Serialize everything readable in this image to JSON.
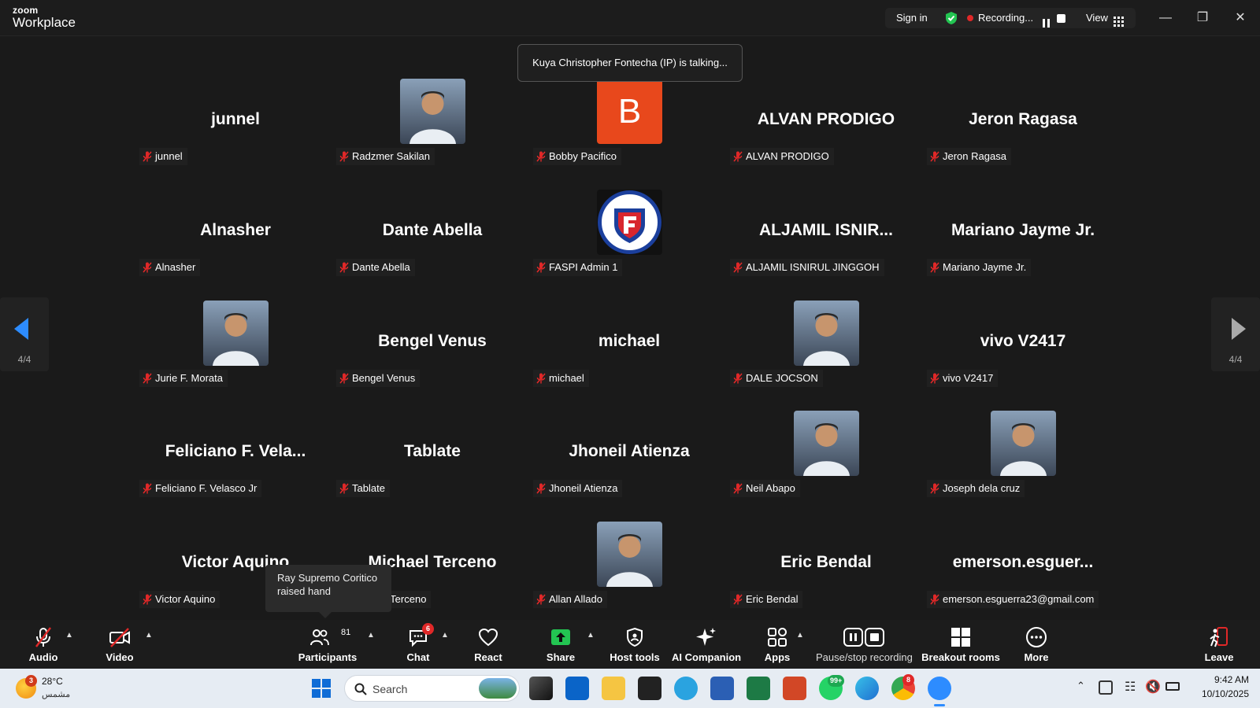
{
  "app": {
    "brand_small": "zoom",
    "brand_large": "Workplace"
  },
  "topbar": {
    "sign_in": "Sign in",
    "recording": "Recording...",
    "view": "View"
  },
  "toast": "Kuya Christopher Fontecha (IP) is talking...",
  "pager": {
    "left": "4/4",
    "right": "4/4"
  },
  "participants": [
    {
      "big": "junnel",
      "label": "junnel",
      "avatar": "none"
    },
    {
      "big": "",
      "label": "Radzmer Sakilan",
      "avatar": "photo"
    },
    {
      "big": "",
      "label": "Bobby Pacifico",
      "avatar": "letter",
      "letter": "B"
    },
    {
      "big": "ALVAN PRODIGO",
      "label": "ALVAN PRODIGO",
      "avatar": "none"
    },
    {
      "big": "Jeron Ragasa",
      "label": "Jeron Ragasa",
      "avatar": "none"
    },
    {
      "big": "Alnasher",
      "label": "Alnasher",
      "avatar": "none"
    },
    {
      "big": "Dante Abella",
      "label": "Dante Abella",
      "avatar": "none"
    },
    {
      "big": "",
      "label": "FASPI Admin 1",
      "avatar": "logo"
    },
    {
      "big": "ALJAMIL  ISNIR...",
      "label": "ALJAMIL  ISNIRUL JINGGOH",
      "avatar": "none"
    },
    {
      "big": "Mariano Jayme Jr.",
      "label": "Mariano Jayme Jr.",
      "avatar": "none"
    },
    {
      "big": "",
      "label": "Jurie F. Morata",
      "avatar": "photo"
    },
    {
      "big": "Bengel Venus",
      "label": "Bengel Venus",
      "avatar": "none"
    },
    {
      "big": "michael",
      "label": "michael",
      "avatar": "none"
    },
    {
      "big": "",
      "label": "DALE JOCSON",
      "avatar": "photo"
    },
    {
      "big": "vivo V2417",
      "label": "vivo V2417",
      "avatar": "none"
    },
    {
      "big": "Feliciano F. Vela...",
      "label": "Feliciano F. Velasco Jr",
      "avatar": "none"
    },
    {
      "big": "Tablate",
      "label": "Tablate",
      "avatar": "none"
    },
    {
      "big": "Jhoneil Atienza",
      "label": "Jhoneil Atienza",
      "avatar": "none"
    },
    {
      "big": "",
      "label": "Neil Abapo",
      "avatar": "photo"
    },
    {
      "big": "",
      "label": "Joseph dela cruz",
      "avatar": "photo"
    },
    {
      "big": "Victor Aquino",
      "label": "Victor Aquino",
      "avatar": "none"
    },
    {
      "big": "Michael Terceno",
      "label": "Michael Terceno",
      "avatar": "none"
    },
    {
      "big": "",
      "label": "Allan Allado",
      "avatar": "photo"
    },
    {
      "big": "Eric Bendal",
      "label": "Eric Bendal",
      "avatar": "none"
    },
    {
      "big": "emerson.esguer...",
      "label": "emerson.esguerra23@gmail.com",
      "avatar": "none"
    }
  ],
  "raised_hand_tooltip": {
    "line1": "Ray Supremo Coritico",
    "line2": "raised hand"
  },
  "toolbar": {
    "audio": "Audio",
    "video": "Video",
    "participants": "Participants",
    "participants_count": "81",
    "chat": "Chat",
    "chat_badge": "6",
    "react": "React",
    "share": "Share",
    "host_tools": "Host tools",
    "ai_companion": "AI Companion",
    "apps": "Apps",
    "pause_stop": "Pause/stop recording",
    "breakout": "Breakout rooms",
    "more": "More",
    "leave": "Leave"
  },
  "taskbar": {
    "weather_temp": "28°C",
    "weather_desc": "مشمس",
    "weather_badge": "3",
    "search_placeholder": "Search",
    "whatsapp_badge": "99+",
    "chrome_badge": "8",
    "time": "9:42 AM",
    "date": "10/10/2025"
  },
  "colors": {
    "accent_blue": "#2d8cff",
    "mic_muted": "#e02828",
    "share_green": "#23c552",
    "letter_avatar": "#e8481c"
  }
}
